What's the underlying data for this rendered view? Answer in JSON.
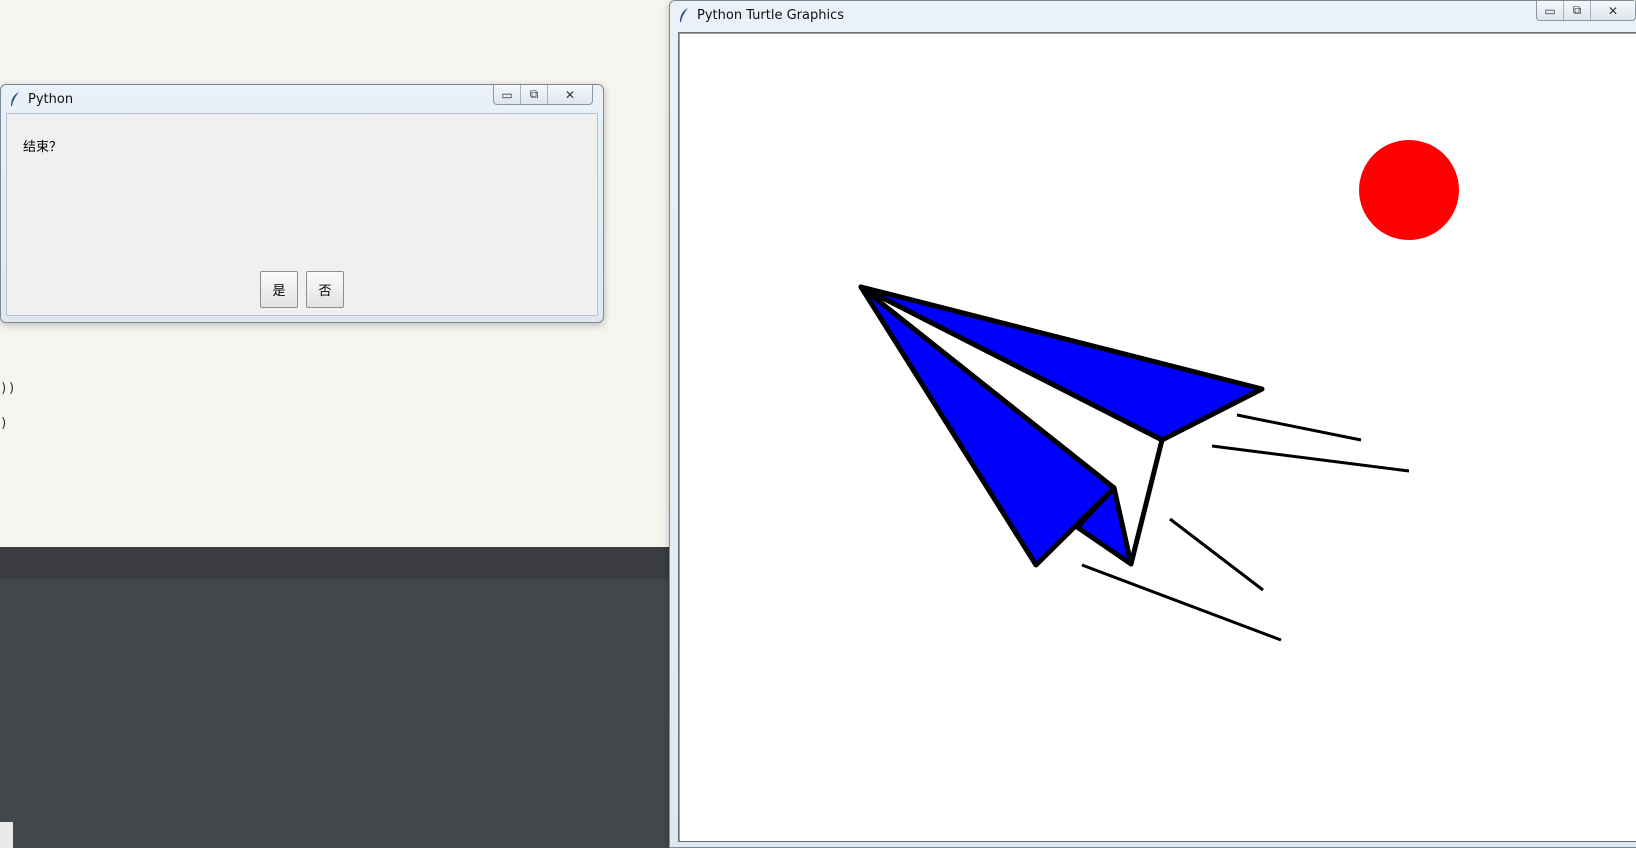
{
  "editor": {
    "code_lines": [
      "))",
      ")"
    ]
  },
  "dialog": {
    "title": "Python",
    "message": "结束？",
    "yes_label": "是",
    "no_label": "否",
    "controls": {
      "minimize": "▭",
      "maximize": "⧉",
      "close": "✕"
    }
  },
  "turtle_window": {
    "title": "Python Turtle Graphics",
    "controls": {
      "minimize": "▭",
      "maximize": "⧉",
      "close": "✕"
    }
  },
  "colors": {
    "plane_fill": "#0000ff",
    "sun_fill": "#ff0000",
    "stroke": "#000000",
    "canvas_bg": "#ffffff"
  }
}
